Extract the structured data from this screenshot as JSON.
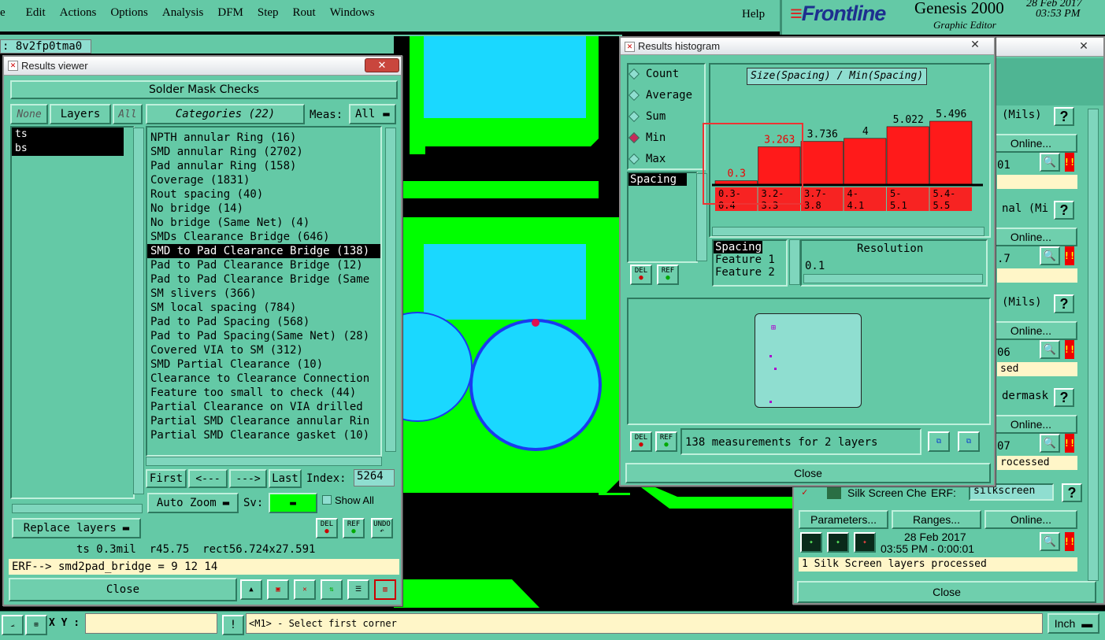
{
  "menu": {
    "items": [
      "e",
      "Edit",
      "Actions",
      "Options",
      "Analysis",
      "DFM",
      "Step",
      "Rout",
      "Windows"
    ],
    "help": "Help"
  },
  "brand": {
    "logo": "Frontline",
    "app": "Genesis 2000",
    "subtitle": "Graphic Editor",
    "date": "28 Feb 2017",
    "time": "03:53 PM"
  },
  "job_field": ": 8v2fp0tma0",
  "results_viewer": {
    "title": "Results viewer",
    "header": "Solder Mask Checks",
    "none_btn": "None",
    "layers_btn": "Layers",
    "all_btn": "All",
    "categories_btn": "Categories (22)",
    "meas_label": "Meas:",
    "meas_value": "All",
    "layers": [
      "ts",
      "bs"
    ],
    "categories": [
      "NPTH annular Ring (16)",
      "SMD annular Ring (2702)",
      "Pad annular Ring (158)",
      "Coverage (1831)",
      "Rout spacing (40)",
      "No bridge (14)",
      "No bridge (Same Net) (4)",
      "SMDs Clearance Bridge (646)",
      "SMD to Pad Clearance Bridge (138)",
      "Pad to Pad Clearance Bridge (12)",
      "Pad to Pad Clearance Bridge (Same",
      "SM slivers (366)",
      "SM local spacing (784)",
      "Pad to Pad Spacing (568)",
      "Pad to Pad Spacing(Same Net) (28)",
      "Covered VIA to SM (312)",
      "SMD Partial Clearance (10)",
      "Clearance to Clearance Connection",
      "Feature too small to check (44)",
      "Partial Clearance on VIA drilled",
      "Partial SMD Clearance annular Rin",
      "Partial SMD Clearance gasket (10)"
    ],
    "selected_index": 8,
    "first_btn": "First",
    "prev_btn": "<---",
    "next_btn": "--->",
    "last_btn": "Last",
    "index_label": "Index:",
    "index_value": "5264",
    "replace_layers": "Replace layers",
    "auto_zoom": "Auto Zoom",
    "sv_label": "Sv:",
    "show_all": "Show All",
    "del": "DEL",
    "ref": "REF",
    "undo": "UNDO",
    "info_line": "ts 0.3mil  r45.75  rect56.724x27.591",
    "erf_line": "ERF--> smd2pad_bridge = 9 12 14",
    "close": "Close"
  },
  "histogram": {
    "title": "Results histogram",
    "modes": [
      "Count",
      "Average",
      "Sum",
      "Min",
      "Max"
    ],
    "selected_mode": "Min",
    "chart_title": "Size(Spacing) / Min(Spacing)",
    "list_item": "Spacing",
    "features": [
      "Spacing",
      "Feature 1",
      "Feature 2"
    ],
    "resolution_label": "Resolution",
    "resolution_value": "0.1",
    "status": "138 measurements for 2 layers",
    "del": "DEL",
    "ref": "REF",
    "close": "Close"
  },
  "chart_data": {
    "type": "bar",
    "title": "Size(Spacing) / Min(Spacing)",
    "categories": [
      "0.3-\n0.4",
      "3.2-\n3.3",
      "3.7-\n3.8",
      "4-\n4.1",
      "5-\n5.1",
      "5.4-\n5.5"
    ],
    "values": [
      0.3,
      3.263,
      3.736,
      4,
      5.022,
      5.496
    ],
    "value_labels": [
      "0.3",
      "3.263",
      "3.736",
      "4",
      "5.022",
      "5.496"
    ],
    "color": "#ff1a1a",
    "ylim": [
      0,
      5.496
    ]
  },
  "checklist": {
    "rows": [
      {
        "q_label": "(Mils)",
        "online": "Online...",
        "text": "01",
        "status": ""
      },
      {
        "q_label": "nal (Mi",
        "online": "Online...",
        "text": ".7",
        "status": ""
      },
      {
        "q_label": "(Mils)",
        "online": "Online...",
        "text": "06",
        "status": "sed"
      },
      {
        "q_label": "dermask",
        "online": "Online...",
        "text": "07",
        "status": "rocessed"
      }
    ],
    "silk_title": "Silk Screen Che",
    "erf_label": "ERF:",
    "erf_value": "silkscreen",
    "parameters": "Parameters...",
    "ranges": "Ranges...",
    "online": "Online...",
    "date": "28 Feb 2017",
    "time": "03:55 PM - 0:00:01",
    "status": "1 Silk Screen layers processed",
    "close": "Close"
  },
  "statusbar": {
    "xy_label": "X Y :",
    "hint": "<M1> - Select first corner",
    "units": "Inch"
  }
}
